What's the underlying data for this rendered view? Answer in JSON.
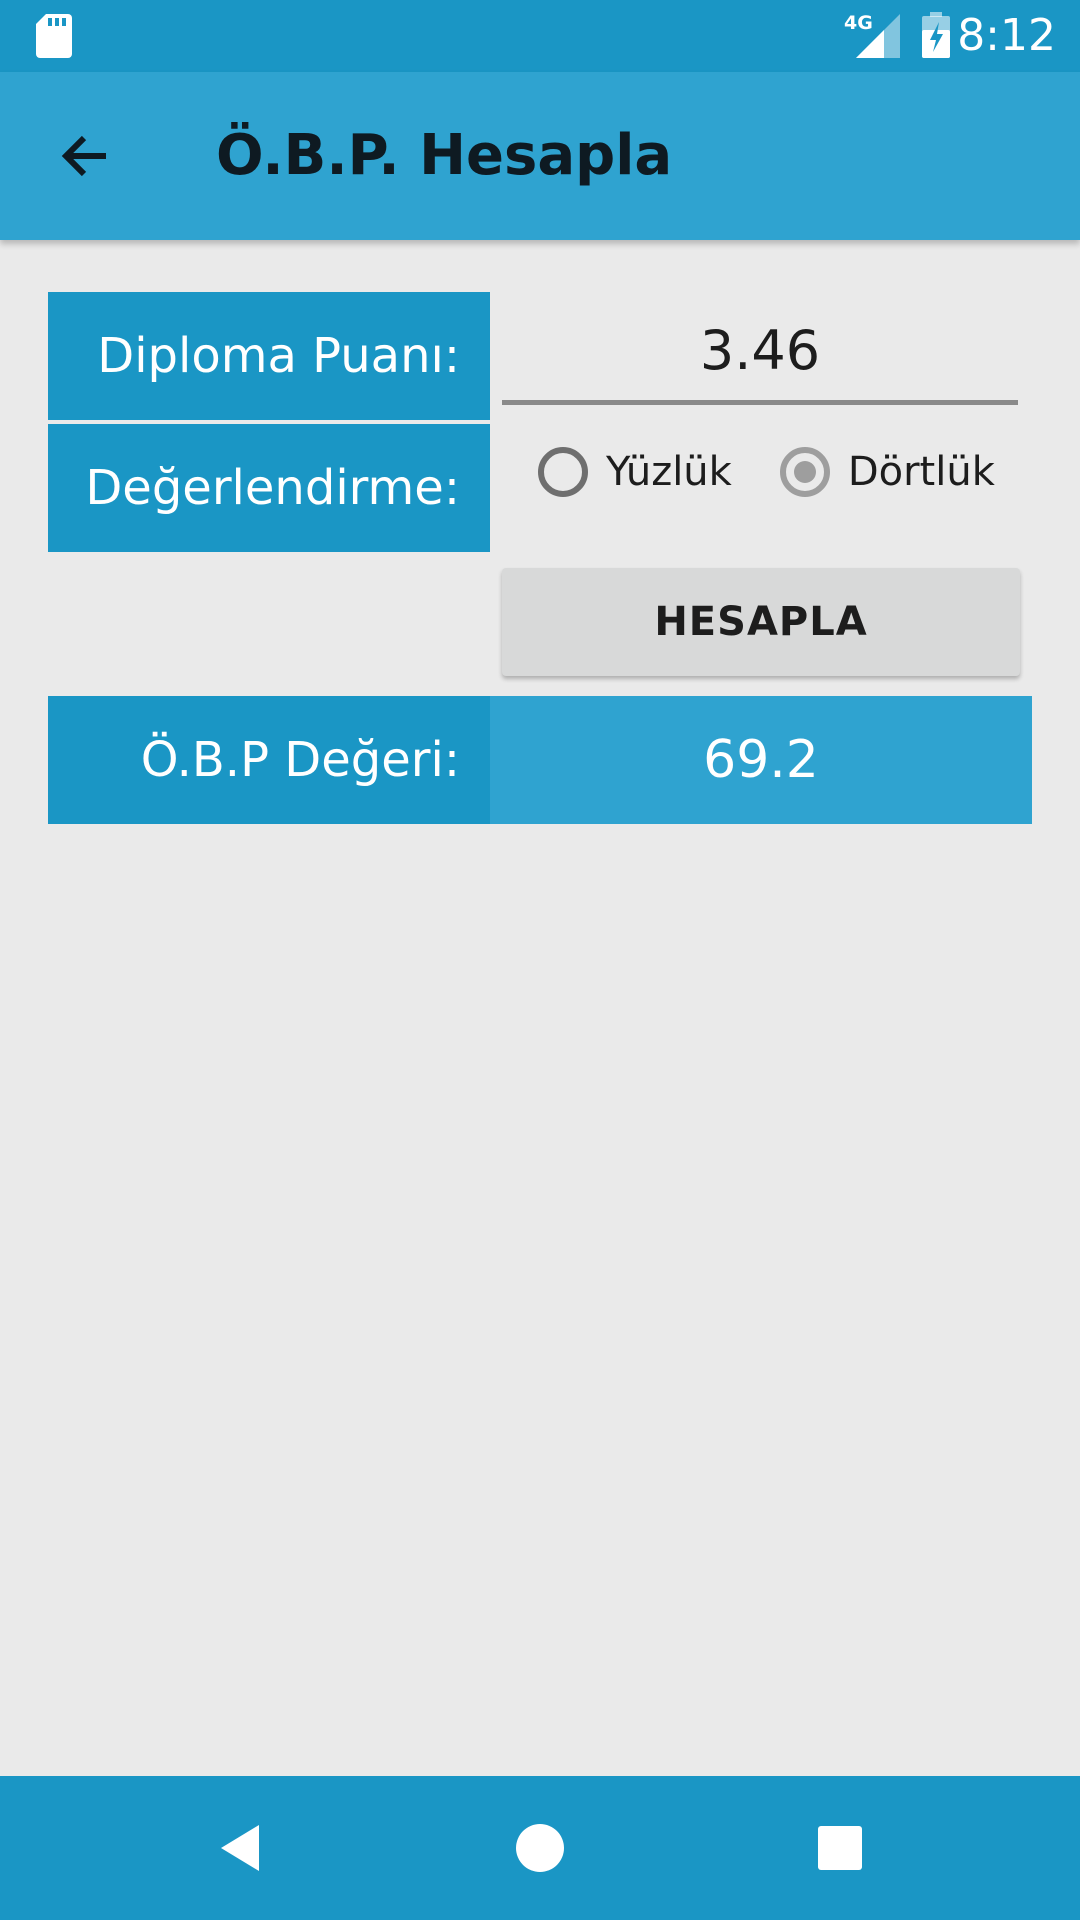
{
  "status_bar": {
    "time": "8:12",
    "network": "4G",
    "icons": [
      "sd-card-icon",
      "signal-icon",
      "battery-charging-icon"
    ]
  },
  "app_bar": {
    "title": "Ö.B.P. Hesapla",
    "back_icon": "arrow-back-icon"
  },
  "form": {
    "diploma_label": "Diploma Puanı:",
    "diploma_value": "3.46",
    "evaluation_label": "Değerlendirme:",
    "evaluation_options": [
      "Yüzlük",
      "Dörtlük"
    ],
    "evaluation_selected": "Dörtlük",
    "calculate_button": "HESAPLA",
    "result_label": "Ö.B.P Değeri:",
    "result_value": "69.2"
  },
  "nav_bar": {
    "icons": [
      "nav-back-icon",
      "nav-home-icon",
      "nav-recents-icon"
    ]
  },
  "colors": {
    "status_bar": "#1A96C5",
    "app_bar": "#2FA3D0",
    "label_bg": "#1A96C5",
    "result_bg": "#2FA3D0",
    "background": "#EAEAEA",
    "button": "#D8D9D9"
  }
}
